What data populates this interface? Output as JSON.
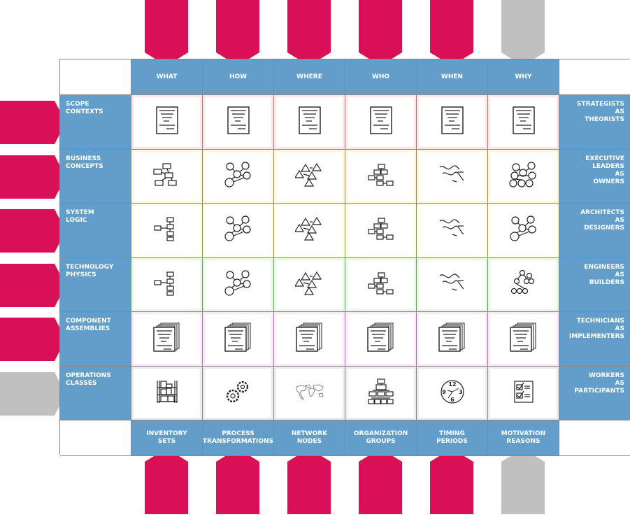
{
  "colors": {
    "header_blue": "#629ec9",
    "arrow_active": "#d91057",
    "arrow_inactive": "#c0c0c0",
    "grid_border": "#888888"
  },
  "columns": [
    {
      "label": "WHAT",
      "footer": [
        "INVENTORY",
        "SETS"
      ],
      "arrow": "active"
    },
    {
      "label": "HOW",
      "footer": [
        "PROCESS",
        "TRANSFORMATIONS"
      ],
      "arrow": "active"
    },
    {
      "label": "WHERE",
      "footer": [
        "NETWORK",
        "NODES"
      ],
      "arrow": "active"
    },
    {
      "label": "WHO",
      "footer": [
        "ORGANIZATION",
        "GROUPS"
      ],
      "arrow": "active"
    },
    {
      "label": "WHEN",
      "footer": [
        "TIMING",
        "PERIODS"
      ],
      "arrow": "active"
    },
    {
      "label": "WHY",
      "footer": [
        "MOTIVATION",
        "REASONS"
      ],
      "arrow": "inactive"
    }
  ],
  "rows": [
    {
      "label": [
        "SCOPE",
        "CONTEXTS"
      ],
      "role": [
        "STRATEGISTS",
        "AS",
        "THEORISTS"
      ],
      "glow": "#fde6e6",
      "arrow": "active",
      "icons": [
        "document-icon",
        "document-icon",
        "document-icon",
        "document-icon",
        "document-icon",
        "document-icon"
      ]
    },
    {
      "label": [
        "BUSINESS",
        "CONCEPTS"
      ],
      "role": [
        "EXECUTIVE",
        "LEADERS",
        "AS",
        "OWNERS"
      ],
      "glow": "#fff6dc",
      "arrow": "active",
      "icons": [
        "box-diagram-icon",
        "circle-network-icon",
        "triangle-network-icon",
        "org-boxes-icon",
        "wave-timeline-icon",
        "circle-cluster-icon"
      ]
    },
    {
      "label": [
        "SYSTEM",
        "LOGIC"
      ],
      "role": [
        "ARCHITECTS",
        "AS",
        "DESIGNERS"
      ],
      "glow": "#fdfcdc",
      "arrow": "active",
      "icons": [
        "box-flow-icon",
        "circle-network-icon",
        "triangle-network-icon",
        "org-boxes-icon",
        "wave-timeline-icon",
        "circle-network-icon"
      ]
    },
    {
      "label": [
        "TECHNOLOGY",
        "PHYSICS"
      ],
      "role": [
        "ENGINEERS",
        "AS",
        "BUILDERS"
      ],
      "glow": "#e4fbe2",
      "arrow": "active",
      "icons": [
        "box-flow-icon",
        "circle-network-icon",
        "triangle-network-icon",
        "org-boxes-icon",
        "wave-timeline-icon",
        "circle-tree-icon"
      ]
    },
    {
      "label": [
        "COMPONENT",
        "ASSEMBLIES"
      ],
      "role": [
        "TECHNICIANS",
        "AS",
        "IMPLEMENTERS"
      ],
      "glow": "#fbe8fb",
      "arrow": "active",
      "icons": [
        "document-stack-icon",
        "document-stack-icon",
        "document-stack-icon",
        "document-stack-icon",
        "document-stack-icon",
        "document-stack-icon"
      ]
    },
    {
      "label": [
        "OPERATIONS",
        "CLASSES"
      ],
      "role": [
        "WORKERS",
        "AS",
        "PARTICIPANTS"
      ],
      "glow": "#ececec",
      "arrow": "inactive",
      "icons": [
        "shelf-inventory-icon",
        "gears-icon",
        "world-map-icon",
        "org-chart-icon",
        "clock-icon",
        "checklist-icon"
      ]
    }
  ],
  "clock_numbers": [
    "12",
    "3",
    "6",
    "9"
  ]
}
